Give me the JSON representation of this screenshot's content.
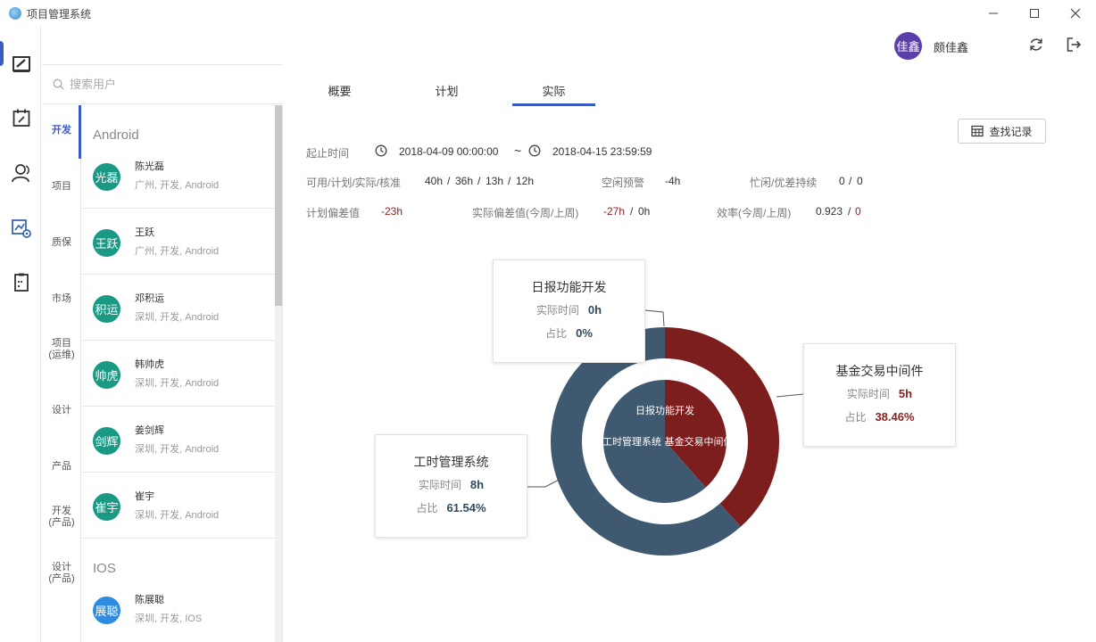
{
  "window": {
    "title": "项目管理系统",
    "minimize": "—",
    "maximize": "☐",
    "close": "✕"
  },
  "header": {
    "user_avatar": "佳鑫",
    "user_name": "颇佳鑫"
  },
  "search": {
    "placeholder": "搜索用户"
  },
  "categories": [
    "开发",
    "项目",
    "质保",
    "市场",
    "项目(运维)",
    "设计",
    "产品",
    "开发(产品)",
    "设计(产品)"
  ],
  "user_groups": [
    {
      "name": "Android",
      "users": [
        {
          "avatar": "光磊",
          "name": "陈光磊",
          "info": "广州, 开发, Android"
        },
        {
          "avatar": "王跃",
          "name": "王跃",
          "info": "广州, 开发, Android"
        },
        {
          "avatar": "积运",
          "name": "邓积运",
          "info": "深圳, 开发, Android"
        },
        {
          "avatar": "帅虎",
          "name": "韩帅虎",
          "info": "深圳, 开发, Android"
        },
        {
          "avatar": "剑辉",
          "name": "姜剑辉",
          "info": "深圳, 开发, Android"
        },
        {
          "avatar": "崔宇",
          "name": "崔宇",
          "info": "深圳, 开发, Android"
        }
      ]
    },
    {
      "name": "IOS",
      "users": [
        {
          "avatar": "展聪",
          "name": "陈展聪",
          "info": "深圳, 开发, IOS"
        }
      ]
    }
  ],
  "tabs": [
    "概要",
    "计划",
    "实际"
  ],
  "active_tab": "实际",
  "query_button": "查找记录",
  "info": {
    "date_label": "起止时间",
    "start": "2018-04-09 00:00:00",
    "tilde": "~",
    "end": "2018-04-15 23:59:59",
    "hours_label": "可用/计划/实际/核准",
    "hours": [
      "40h",
      "36h",
      "13h",
      "12h"
    ],
    "slash": "/",
    "idle_label": "空闲预警",
    "idle_value": "-4h",
    "busy_label": "忙闲/优差持续",
    "busy_values": [
      "0",
      "0"
    ],
    "plan_dev_label": "计划偏差值",
    "plan_dev_value": "-23h",
    "actual_dev_label": "实际偏差值(今周/上周)",
    "actual_dev_values": [
      "-27h",
      "0h"
    ],
    "eff_label": "效率(今周/上周)",
    "eff_values": [
      "0.923",
      "0"
    ]
  },
  "colors": {
    "dark": "#3f5a70",
    "red": "#7d1e1e",
    "accent": "#3b5bc4"
  },
  "chart_data": {
    "type": "pie",
    "series": [
      {
        "name": "工时管理系统",
        "time": "8h",
        "pct": "61.54%",
        "value": 8
      },
      {
        "name": "基金交易中间件",
        "time": "5h",
        "pct": "38.46%",
        "value": 5
      },
      {
        "name": "日报功能开发",
        "time": "0h",
        "pct": "0%",
        "value": 0
      }
    ],
    "tip_time_label": "实际时间",
    "tip_pct_label": "占比"
  }
}
